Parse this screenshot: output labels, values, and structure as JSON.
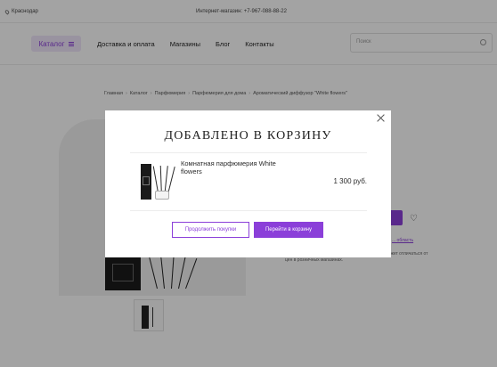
{
  "topbar": {
    "city": "Краснодар",
    "shop_phone": "Интернет-магазин: +7-967-088-88-22"
  },
  "header": {
    "catalog_label": "Каталог",
    "nav": [
      "Доставка и оплата",
      "Магазины",
      "Блог",
      "Контакты"
    ],
    "search_placeholder": "Поиск"
  },
  "breadcrumb": [
    "Главная",
    "Каталог",
    "Парфюмерия",
    "Парфюмерия для дома",
    "Ароматический диффузор \"White flowers\""
  ],
  "background": {
    "region_link": "... область",
    "delivery_note": "действительна только для интернет-магазина и может отличаться от цен в розничных магазинах."
  },
  "modal": {
    "title": "ДОБАВЛЕНО В КОРЗИНУ",
    "item_name": "Комнатная парфюмерия White flowers",
    "item_price": "1 300 руб.",
    "continue_label": "Продолжить покупки",
    "cart_label": "Перейти в корзину"
  },
  "colors": {
    "accent": "#8b3fd9",
    "overlay": "rgba(0,0,0,0.36)"
  }
}
